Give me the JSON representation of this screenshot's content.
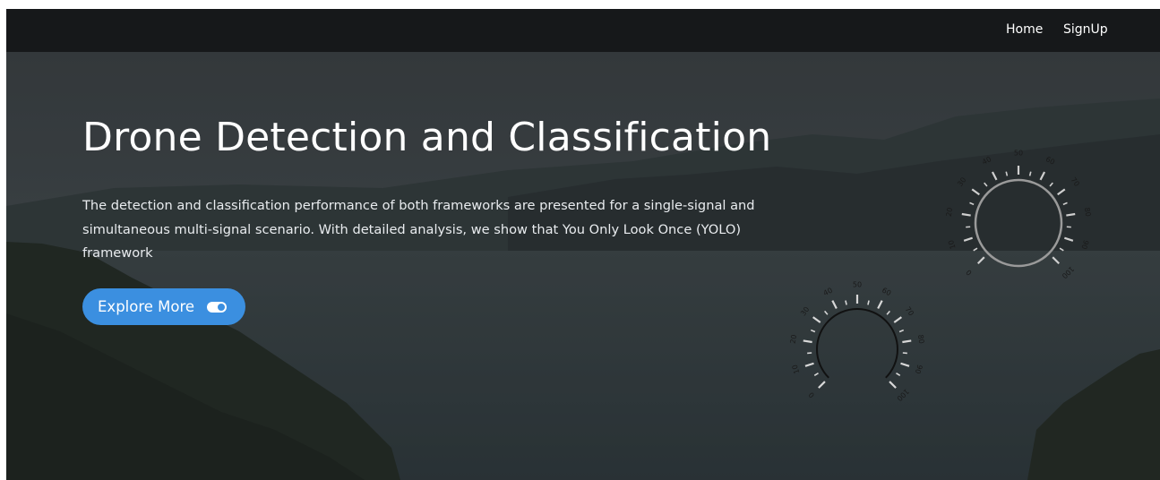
{
  "nav": {
    "links": [
      {
        "label": "Home"
      },
      {
        "label": "SignUp"
      }
    ]
  },
  "hero": {
    "title": "Drone Detection and Classification",
    "description": "The detection and classification performance of both frameworks are presented for a single-signal and simultaneous multi-signal scenario. With detailed analysis, we show that You Only Look Once (YOLO) framework",
    "cta_label": "Explore More",
    "cta_icon": "toggle-on-icon"
  },
  "gauges": {
    "gauge_1": {
      "ticks": [
        "0",
        "10",
        "20",
        "30",
        "40",
        "50",
        "60",
        "70",
        "80",
        "90",
        "100"
      ],
      "ring": "full-circle",
      "color": "#9a9a9a"
    },
    "gauge_2": {
      "ticks": [
        "0",
        "10",
        "20",
        "30",
        "40",
        "50",
        "60",
        "70",
        "80",
        "90",
        "100"
      ],
      "ring": "open-arc",
      "color": "#111111"
    }
  },
  "colors": {
    "accent": "#3b8fe0",
    "navbar": "#1e2123",
    "text": "#ffffff"
  }
}
